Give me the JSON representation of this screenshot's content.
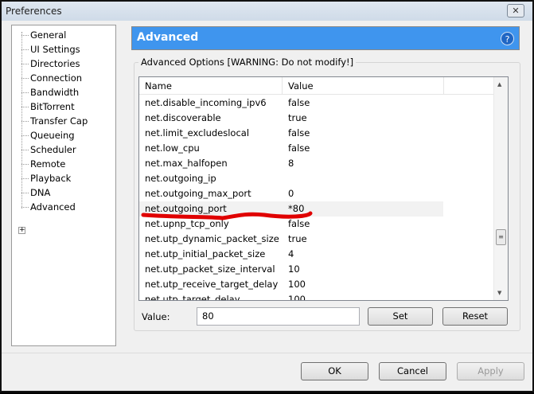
{
  "window": {
    "title": "Preferences",
    "close": "✕"
  },
  "tree": {
    "items": [
      {
        "label": "General"
      },
      {
        "label": "UI Settings"
      },
      {
        "label": "Directories"
      },
      {
        "label": "Connection"
      },
      {
        "label": "Bandwidth"
      },
      {
        "label": "BitTorrent"
      },
      {
        "label": "Transfer Cap"
      },
      {
        "label": "Queueing"
      },
      {
        "label": "Scheduler"
      },
      {
        "label": "Remote"
      },
      {
        "label": "Playback"
      },
      {
        "label": "DNA"
      },
      {
        "label": "Advanced"
      }
    ],
    "expander": "+"
  },
  "header": {
    "title": "Advanced",
    "help": "?"
  },
  "group": {
    "label": "Advanced Options [WARNING: Do not modify!]"
  },
  "list": {
    "columns": [
      "Name",
      "Value"
    ],
    "rows": [
      {
        "name": "net.disable_incoming_ipv6",
        "value": "false"
      },
      {
        "name": "net.discoverable",
        "value": "true"
      },
      {
        "name": "net.limit_excludeslocal",
        "value": "false"
      },
      {
        "name": "net.low_cpu",
        "value": "false"
      },
      {
        "name": "net.max_halfopen",
        "value": "8"
      },
      {
        "name": "net.outgoing_ip",
        "value": ""
      },
      {
        "name": "net.outgoing_max_port",
        "value": "0"
      },
      {
        "name": "net.outgoing_port",
        "value": "*80"
      },
      {
        "name": "net.upnp_tcp_only",
        "value": "false"
      },
      {
        "name": "net.utp_dynamic_packet_size",
        "value": "true"
      },
      {
        "name": "net.utp_initial_packet_size",
        "value": "4"
      },
      {
        "name": "net.utp_packet_size_interval",
        "value": "10"
      },
      {
        "name": "net.utp_receive_target_delay",
        "value": "100"
      },
      {
        "name": "net.utp_target_delay",
        "value": "100"
      }
    ],
    "selected_index": 7
  },
  "value": {
    "label": "Value:",
    "current": "80",
    "set": "Set",
    "reset": "Reset"
  },
  "buttons": {
    "ok": "OK",
    "cancel": "Cancel",
    "apply": "Apply"
  },
  "annotation_color": "#e00000"
}
